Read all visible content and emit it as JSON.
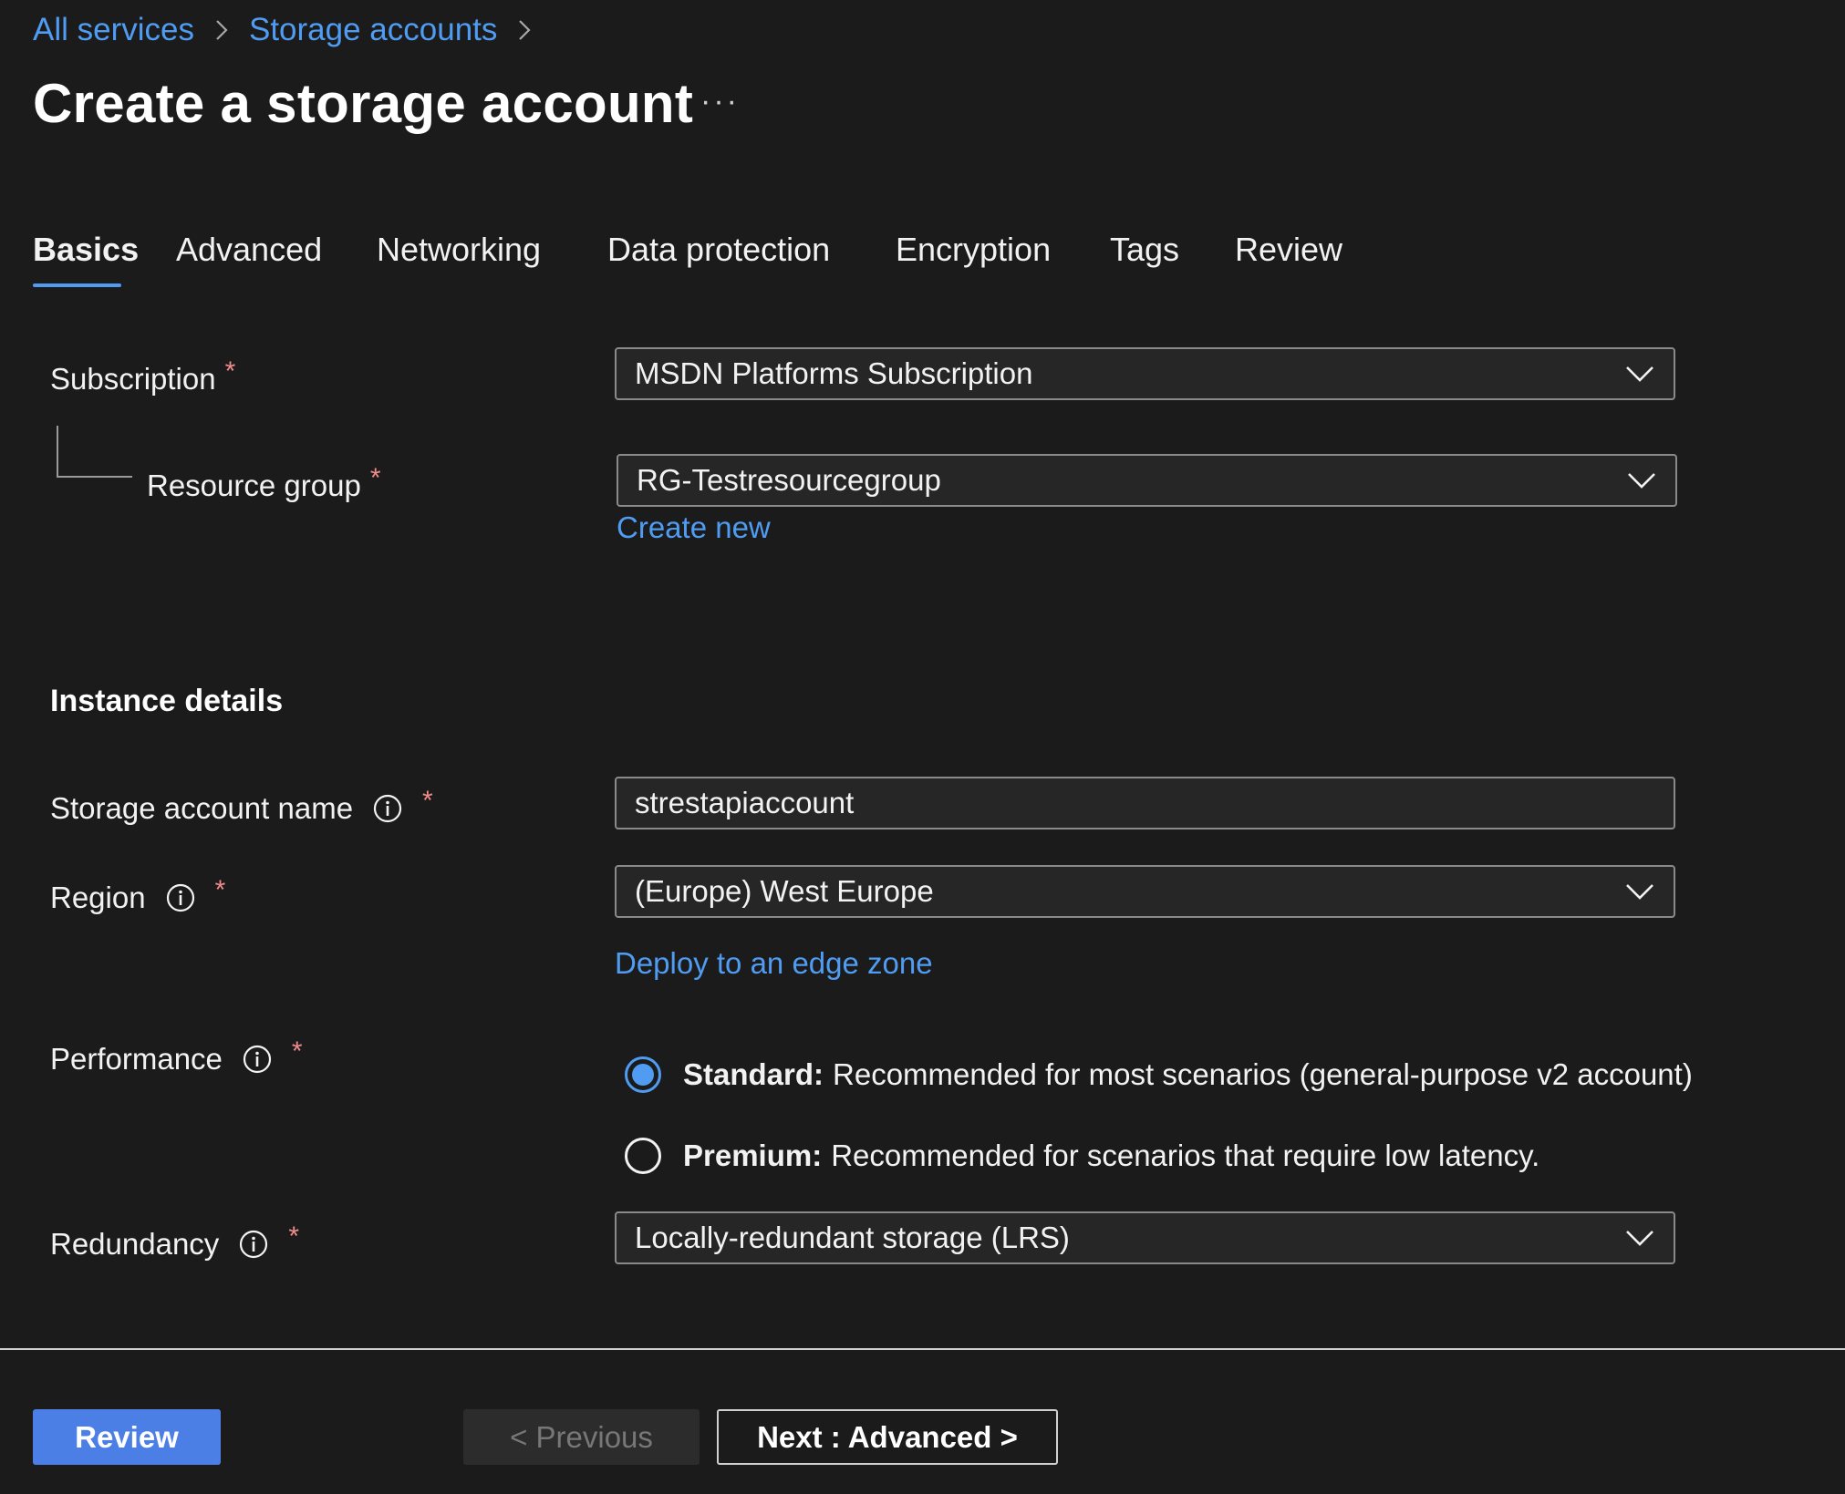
{
  "breadcrumb": {
    "items": [
      "All services",
      "Storage accounts"
    ]
  },
  "page": {
    "title": "Create a storage account",
    "more": "···"
  },
  "tabs": [
    "Basics",
    "Advanced",
    "Networking",
    "Data protection",
    "Encryption",
    "Tags",
    "Review"
  ],
  "active_tab": "Basics",
  "project": {
    "subscription_label": "Subscription",
    "subscription_value": "MSDN Platforms Subscription",
    "resource_group_label": "Resource group",
    "resource_group_value": "RG-Testresourcegroup",
    "create_new": "Create new"
  },
  "instance": {
    "section_title": "Instance details",
    "name_label": "Storage account name",
    "name_value": "strestapiaccount",
    "region_label": "Region",
    "region_value": "(Europe) West Europe",
    "edge_zone_link": "Deploy to an edge zone",
    "performance_label": "Performance",
    "performance_options": [
      {
        "strong": "Standard:",
        "text": "Recommended for most scenarios (general-purpose v2 account)",
        "selected": true
      },
      {
        "strong": "Premium:",
        "text": "Recommended for scenarios that require low latency.",
        "selected": false
      }
    ],
    "redundancy_label": "Redundancy",
    "redundancy_value": "Locally-redundant storage (LRS)"
  },
  "required_mark": "*",
  "footer": {
    "review": "Review",
    "previous": "< Previous",
    "next": "Next : Advanced >"
  },
  "colors": {
    "background": "#1b1b1b",
    "accent": "#4f9cf2",
    "primary_button": "#4c7fe6",
    "required": "#f08b8b"
  }
}
